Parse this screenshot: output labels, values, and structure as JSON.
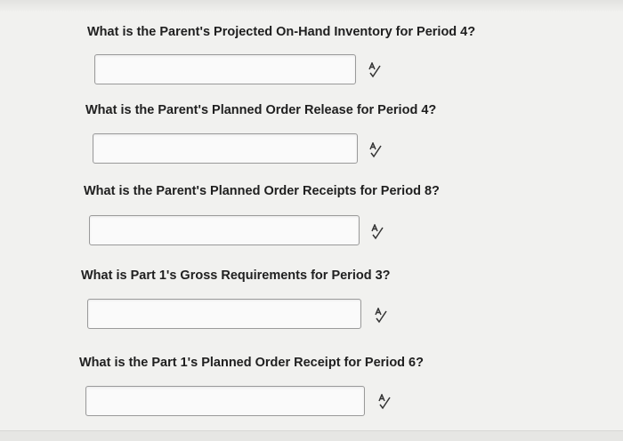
{
  "questions": [
    {
      "text": "What is the Parent's Projected On-Hand Inventory for Period 4?",
      "answer": "",
      "icon": "spellcheck-icon"
    },
    {
      "text": "What is the Parent's Planned Order Release for Period 4?",
      "answer": "",
      "icon": "spellcheck-icon"
    },
    {
      "text": "What is the Parent's Planned Order Receipts for Period 8?",
      "answer": "",
      "icon": "spellcheck-icon"
    },
    {
      "text": "What is Part 1's Gross Requirements for Period 3?",
      "answer": "",
      "icon": "spellcheck-icon"
    },
    {
      "text": "What is the Part 1's Planned Order Receipt for Period 6?",
      "answer": "",
      "icon": "spellcheck-icon"
    }
  ]
}
